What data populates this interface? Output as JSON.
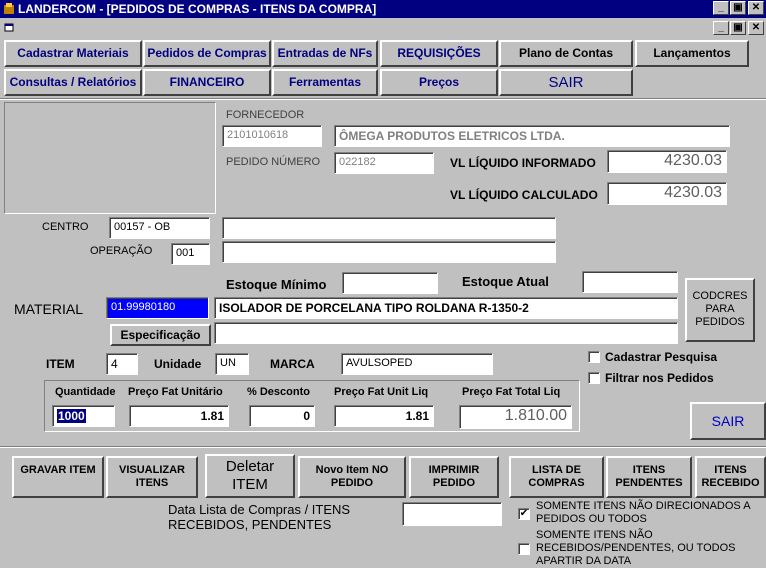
{
  "window": {
    "title": "LANDERCOM - [PEDIDOS DE COMPRAS  - ITENS DA COMPRA]",
    "minimize": "_",
    "restore": "▣",
    "close": "✕"
  },
  "nav": {
    "cadastrar": "Cadastrar Materiais",
    "pedidos": "Pedidos de Compras",
    "entradas": "Entradas de NFs",
    "requisicoes": "REQUISIÇÕES",
    "plano": "Plano de Contas",
    "lancamentos": "Lançamentos",
    "consultas": "Consultas / Relatórios",
    "financeiro": "FINANCEIRO",
    "ferramentas": "Ferramentas",
    "precos": "Preços",
    "sair": "SAIR"
  },
  "header": {
    "fornecedor_label": "FORNECEDOR",
    "fornecedor_code": "2101010618",
    "fornecedor_name": "ÔMEGA PRODUTOS ELETRICOS LTDA.",
    "pedido_label": "PEDIDO NÚMERO",
    "pedido_numero": "022182",
    "vl_informado_label": "VL LÍQUIDO INFORMADO",
    "vl_informado": "4230.03",
    "vl_calculado_label": "VL LÍQUIDO CALCULADO",
    "vl_calculado": "4230.03"
  },
  "form": {
    "centro_label": "CENTRO",
    "centro_value": "00157 - OB",
    "operacao_label": "OPERAÇÃO",
    "operacao_value": "001",
    "estoque_minimo_label": "Estoque Mínimo",
    "estoque_atual_label": "Estoque Atual",
    "material_label": "MATERIAL",
    "material_code": "01.99980180",
    "material_desc": "ISOLADOR DE PORCELANA TIPO ROLDANA R-1350-2",
    "especificacao_btn": "Especificação",
    "codcres_btn": "CODCRES PARA PEDIDOS",
    "item_label": "ITEM",
    "item_value": "4",
    "unidade_label": "Unidade",
    "unidade_value": "UN",
    "marca_label": "MARCA",
    "marca_value": "AVULSOPED",
    "cadastrar_pesquisa": "Cadastrar Pesquisa",
    "filtrar_pedidos": "Filtrar  nos Pedidos",
    "sair_btn": "SAIR"
  },
  "grid": {
    "quantidade_label": "Quantidade",
    "quantidade": "1000",
    "preco_unit_label": "Preço Fat Unitário",
    "preco_unit": "1.81",
    "desconto_label": "% Desconto",
    "desconto": "0",
    "preco_liq_label": "Preço Fat Unit Liq",
    "preco_liq": "1.81",
    "preco_total_label": "Preço Fat Total Liq",
    "preco_total": "1.810.00"
  },
  "actions": {
    "gravar": "GRAVAR ITEM",
    "visualizar": "VISUALIZAR ITENS",
    "deletar": "Deletar ITEM",
    "novo": "Novo Item NO PEDIDO",
    "imprimir": "IMPRIMIR PEDIDO",
    "lista": "LISTA DE COMPRAS",
    "pendentes": "ITENS PENDENTES",
    "recebidos": "ITENS RECEBIDO"
  },
  "bottom": {
    "data_lista_label": "Data Lista de Compras / ITENS RECEBIDOS, PENDENTES",
    "somente_nao_direcionados": "SOMENTE ITENS NÃO DIRECIONADOS A PEDIDOS OU TODOS",
    "somente_nao_recebidos": "SOMENTE ITENS NÃO RECEBIDOS/PENDENTES, OU TODOS APARTIR DA DATA",
    "check_mark": "✔"
  }
}
